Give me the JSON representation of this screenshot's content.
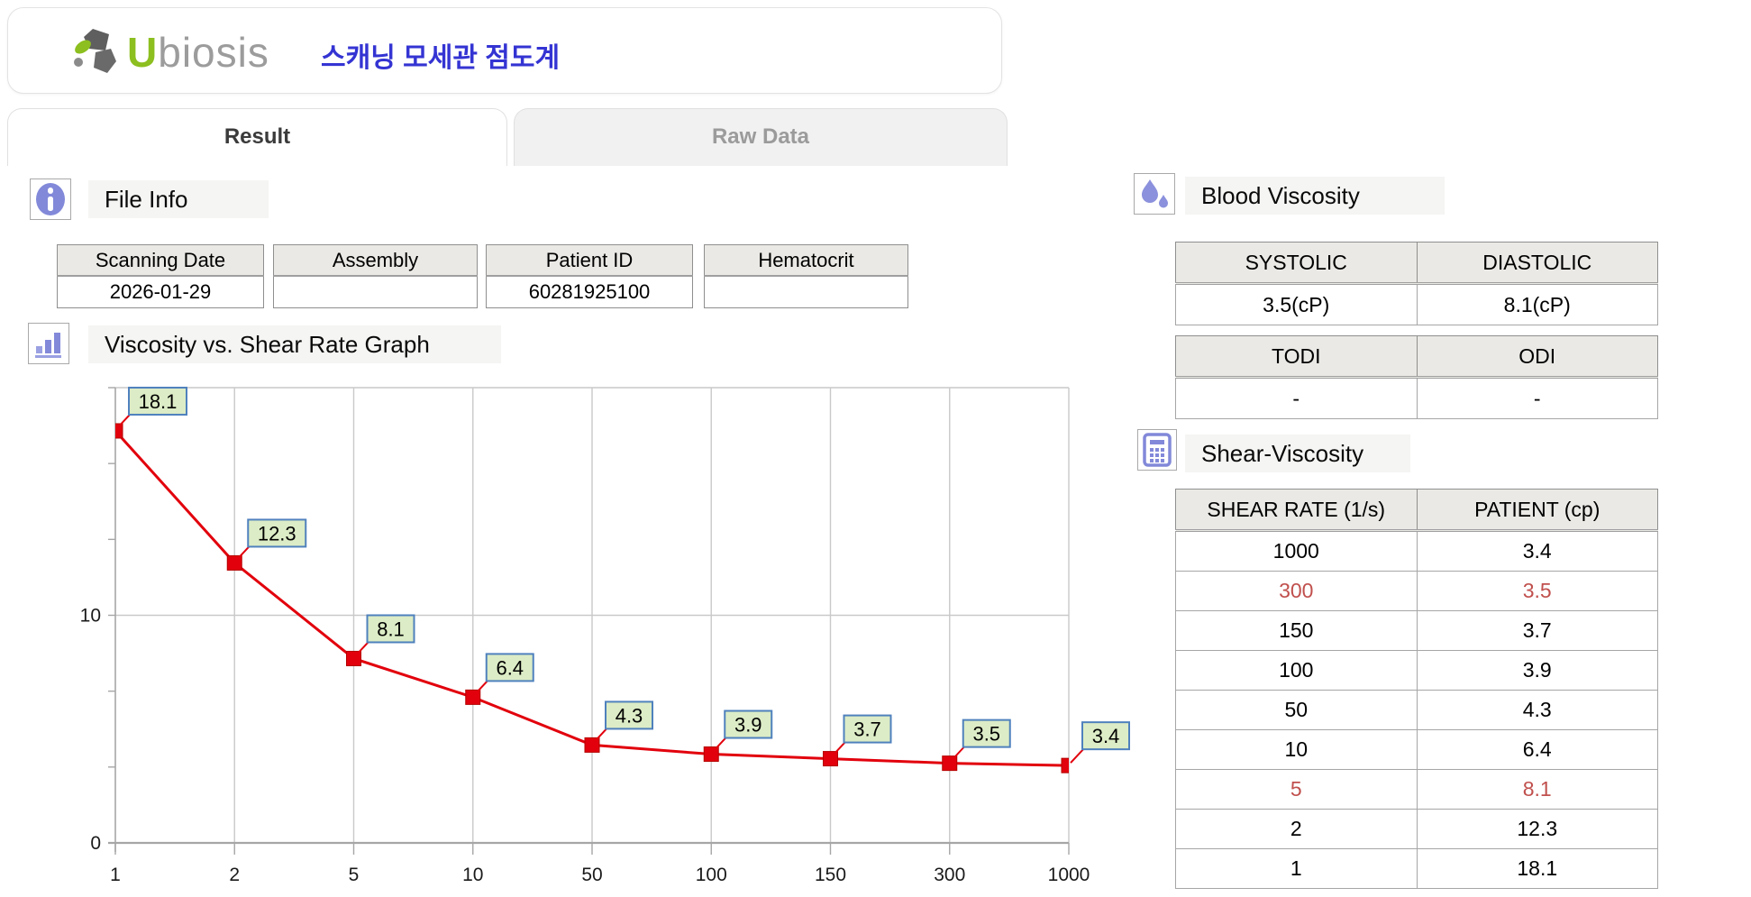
{
  "header": {
    "logo_u": "U",
    "logo_rest": "biosis",
    "subtitle": "스캐닝 모세관 점도계"
  },
  "tabs": {
    "result": "Result",
    "raw_data": "Raw Data"
  },
  "file_info": {
    "title": "File Info",
    "fields": [
      {
        "label": "Scanning Date",
        "value": "2026-01-29"
      },
      {
        "label": "Assembly",
        "value": ""
      },
      {
        "label": "Patient ID",
        "value": "60281925100"
      },
      {
        "label": "Hematocrit",
        "value": ""
      }
    ]
  },
  "graph_section": {
    "title": "Viscosity vs. Shear Rate Graph"
  },
  "chart_data": {
    "type": "line",
    "title": "Viscosity vs. Shear Rate Graph",
    "categories": [
      "1",
      "2",
      "5",
      "10",
      "50",
      "100",
      "150",
      "300",
      "1000"
    ],
    "values": [
      18.1,
      12.3,
      8.1,
      6.4,
      4.3,
      3.9,
      3.7,
      3.5,
      3.4
    ],
    "point_labels": [
      "18.1",
      "12.3",
      "8.1",
      "6.4",
      "4.3",
      "3.9",
      "3.7",
      "3.5",
      "3.4"
    ],
    "xlabel": "",
    "ylabel": "",
    "ylim": [
      0,
      20
    ],
    "ytick_labels": [
      "0",
      "10"
    ],
    "yticks": [
      0,
      10
    ],
    "y_minor_interval": 3.3333,
    "grid": true,
    "legend": "none",
    "line_color": "#e2000c",
    "marker": "square",
    "marker_color": "#e2000c",
    "label_box_fill": "#dcecc6",
    "label_box_border": "#4f81bd",
    "grid_color": "#c9c9c9",
    "axis_color": "#a6a6a6"
  },
  "blood_viscosity": {
    "title": "Blood Viscosity",
    "pressure_table": {
      "headers": [
        "SYSTOLIC",
        "DIASTOLIC"
      ],
      "values": [
        "3.5(cP)",
        "8.1(cP)"
      ]
    },
    "index_table": {
      "headers": [
        "TODI",
        "ODI"
      ],
      "values": [
        "-",
        "-"
      ]
    }
  },
  "shear_viscosity": {
    "title": "Shear-Viscosity",
    "headers": [
      "SHEAR RATE (1/s)",
      "PATIENT (cp)"
    ],
    "rows": [
      {
        "shear": "1000",
        "patient": "3.4",
        "highlight": false
      },
      {
        "shear": "300",
        "patient": "3.5",
        "highlight": true
      },
      {
        "shear": "150",
        "patient": "3.7",
        "highlight": false
      },
      {
        "shear": "100",
        "patient": "3.9",
        "highlight": false
      },
      {
        "shear": "50",
        "patient": "4.3",
        "highlight": false
      },
      {
        "shear": "10",
        "patient": "6.4",
        "highlight": false
      },
      {
        "shear": "5",
        "patient": "8.1",
        "highlight": true
      },
      {
        "shear": "2",
        "patient": "12.3",
        "highlight": false
      },
      {
        "shear": "1",
        "patient": "18.1",
        "highlight": false
      }
    ]
  },
  "colors": {
    "accent_blue": "#3434d3",
    "icon_purple": "#8289d9",
    "logo_green": "#8cbf1f",
    "highlight_red": "#c0504d",
    "header_cell_bg": "#eae9e5",
    "section_label_bg": "#f5f5f3"
  }
}
